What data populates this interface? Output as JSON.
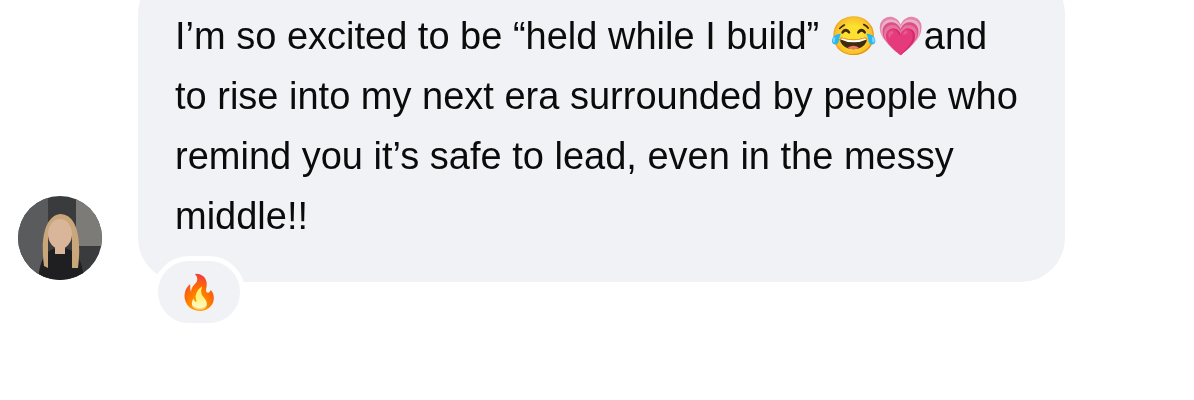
{
  "message": {
    "text": "I’m so excited to be “held while I build” 😂💗and to rise into my next era surrounded by people who remind you it’s safe to lead, even in the messy middle!!",
    "reactions": [
      "🔥"
    ]
  }
}
